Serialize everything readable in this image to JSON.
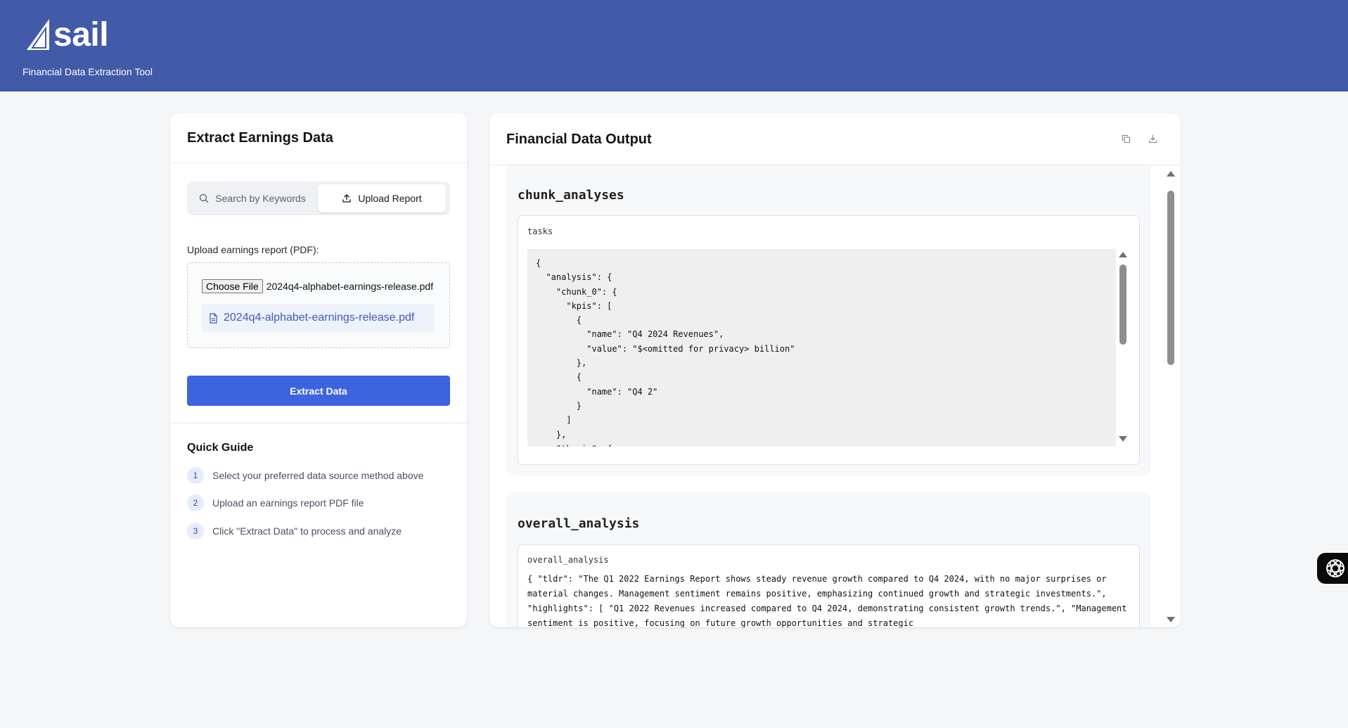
{
  "header": {
    "logo_text": "sail",
    "tagline": "Financial Data Extraction Tool",
    "bg_color": "#415ba9"
  },
  "left_panel": {
    "title": "Extract Earnings Data",
    "tabs": [
      {
        "label": "Search by Keywords",
        "icon": "search-icon",
        "active": false
      },
      {
        "label": "Upload Report",
        "icon": "upload-icon",
        "active": true
      }
    ],
    "upload_label": "Upload earnings report (PDF):",
    "choose_file_label": "Choose File",
    "file_name": "2024q4-alphabet-earnings-release.pdf",
    "chip_file_name": "2024q4-alphabet-earnings-release.pdf",
    "extract_button": "Extract Data",
    "guide": {
      "title": "Quick Guide",
      "steps": [
        {
          "num": "1",
          "text": "Select your preferred data source method above"
        },
        {
          "num": "2",
          "text": "Upload an earnings report PDF file"
        },
        {
          "num": "3",
          "text": "Click \"Extract Data\" to process and analyze"
        }
      ]
    }
  },
  "right_panel": {
    "title": "Financial Data Output",
    "actions": [
      {
        "name": "copy-icon"
      },
      {
        "name": "download-icon"
      }
    ],
    "sections": [
      {
        "title": "chunk_analyses",
        "box_label": "tasks",
        "code": "{\n  \"analysis\": {\n    \"chunk_0\": {\n      \"kpis\": [\n        {\n          \"name\": \"Q4 2024 Revenues\",\n          \"value\": \"$<omitted for privacy> billion\"\n        },\n        {\n          \"name\": \"Q4 2\"\n        }\n      ]\n    },\n    \"thesis\": {"
      },
      {
        "title": "overall_analysis",
        "box_label": "overall_analysis",
        "text": "{ \"tldr\": \"The Q1 2022 Earnings Report shows steady revenue growth compared to Q4 2024, with no major surprises or material changes. Management sentiment remains positive, emphasizing continued growth and strategic investments.\", \"highlights\": [ \"Q1 2022 Revenues increased compared to Q4 2024, demonstrating consistent growth trends.\", \"Management sentiment is positive, focusing on future growth opportunities and strategic"
      }
    ]
  },
  "colors": {
    "primary_button": "#3e63de",
    "accent_text": "#3d5bbd",
    "page_bg": "#f5f6f8"
  }
}
